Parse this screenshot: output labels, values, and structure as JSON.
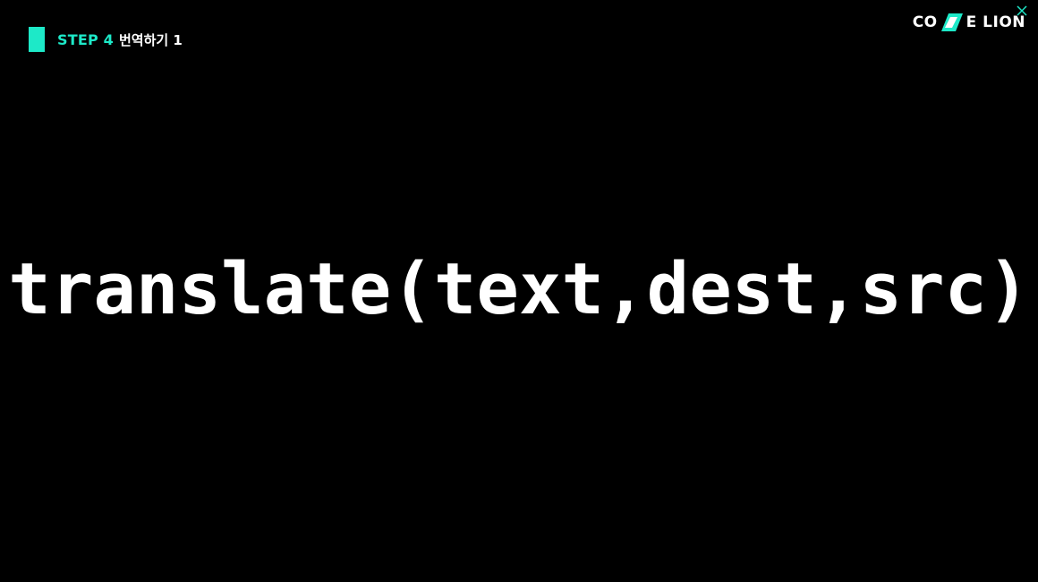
{
  "header": {
    "step": "STEP 4",
    "title": "번역하기 1"
  },
  "logo": {
    "left_text": "CO",
    "right_text": "E LION",
    "accent_color": "#1de9c8",
    "icon": "code-lion-slash-mark"
  },
  "main": {
    "code": "translate(text,dest,src)"
  },
  "colors": {
    "background": "#000000",
    "accent": "#1de9c8",
    "text": "#ffffff"
  }
}
